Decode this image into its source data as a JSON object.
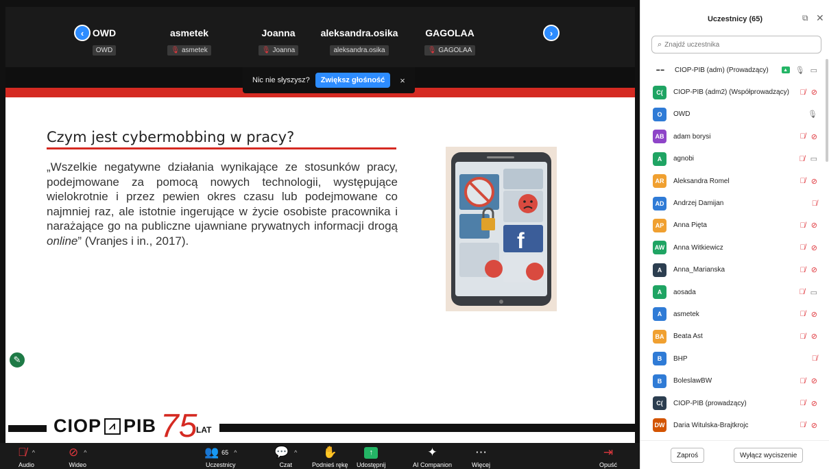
{
  "strip": {
    "tiles": [
      {
        "name": "OWD",
        "label": "OWD",
        "muted": false
      },
      {
        "name": "asmetek",
        "label": "asmetek",
        "muted": true
      },
      {
        "name": "Joanna",
        "label": "Joanna",
        "muted": true
      },
      {
        "name": "aleksandra.osika",
        "label": "aleksandra.osika",
        "muted": false
      },
      {
        "name": "GAGOLAA",
        "label": "GAGOLAA",
        "muted": true
      }
    ]
  },
  "notification": {
    "text": "Nic nie słyszysz?",
    "button": "Zwiększ głośność",
    "close": "×"
  },
  "slide": {
    "title": "Czym jest cybermobbing w pracy?",
    "body": "„Wszelkie negatywne działania wynikające ze stosunków pracy, podejmowane za pomocą nowych technologii, występujące wielokrotnie i przez pewien okres czasu lub podejmowane co najmniej raz, ale istotnie ingerujące w życie osobiste pracownika i narażające go na publiczne ujawniane prywatnych informacji drogą ",
    "body_italic": "online",
    "body_end": "” (Vranjes i in., 2017).",
    "logo_left": "CIOP",
    "logo_right": "PIB",
    "logo_number": "75",
    "logo_lat": "LAT"
  },
  "toolbar": {
    "audio": "Audio",
    "video": "Wideo",
    "participants": "Uczestnicy",
    "participants_count": "65",
    "chat": "Czat",
    "raise_hand": "Podnieś rękę",
    "share": "Udostępnij",
    "ai": "AI Companion",
    "more": "Więcej",
    "leave": "Opuść"
  },
  "panel": {
    "title": "Uczestnicy (65)",
    "search_placeholder": "Znajdź uczestnika",
    "invite": "Zaproś",
    "mute_all": "Wyłącz wyciszenie",
    "participants": [
      {
        "initials": "",
        "name": "CIOP-PIB (adm) (Prowadzący)",
        "color": "#ffffff",
        "mic": "on",
        "cam": "on",
        "logo": true,
        "share": true
      },
      {
        "initials": "C(",
        "name": "CIOP-PIB (adm2) (Współprowadzący)",
        "color": "#1fa463",
        "mic": "muted",
        "cam": "muted"
      },
      {
        "initials": "O",
        "name": "OWD",
        "color": "#2f7bd6",
        "mic": "on",
        "cam": "none"
      },
      {
        "initials": "AB",
        "name": "adam borysi",
        "color": "#8e44c8",
        "mic": "muted",
        "cam": "muted"
      },
      {
        "initials": "A",
        "name": "agnobi",
        "color": "#1fa463",
        "mic": "muted",
        "cam": "on"
      },
      {
        "initials": "AR",
        "name": "Aleksandra Romel",
        "color": "#f0a030",
        "mic": "muted",
        "cam": "muted"
      },
      {
        "initials": "AD",
        "name": "Andrzej Damijan",
        "color": "#2f7bd6",
        "mic": "muted",
        "cam": "none"
      },
      {
        "initials": "AP",
        "name": "Anna Pięta",
        "color": "#f0a030",
        "mic": "muted",
        "cam": "muted"
      },
      {
        "initials": "AW",
        "name": "Anna Witkiewicz",
        "color": "#1fa463",
        "mic": "muted",
        "cam": "muted"
      },
      {
        "initials": "A",
        "name": "Anna_Marianska",
        "color": "#2c3e50",
        "mic": "muted",
        "cam": "muted"
      },
      {
        "initials": "A",
        "name": "aosada",
        "color": "#1fa463",
        "mic": "muted",
        "cam": "on"
      },
      {
        "initials": "A",
        "name": "asmetek",
        "color": "#2f7bd6",
        "mic": "muted",
        "cam": "muted"
      },
      {
        "initials": "BA",
        "name": "Beata Ast",
        "color": "#f0a030",
        "mic": "muted",
        "cam": "muted"
      },
      {
        "initials": "B",
        "name": "BHP",
        "color": "#2f7bd6",
        "mic": "muted",
        "cam": "none"
      },
      {
        "initials": "B",
        "name": "BoleslawBW",
        "color": "#2f7bd6",
        "mic": "muted",
        "cam": "muted"
      },
      {
        "initials": "C(",
        "name": "CIOP-PIB (prowadzący)",
        "color": "#2c3e50",
        "mic": "muted",
        "cam": "muted"
      },
      {
        "initials": "DW",
        "name": "Daria Witulska-Brajtkrojc",
        "color": "#d35400",
        "mic": "muted",
        "cam": "muted"
      }
    ]
  }
}
